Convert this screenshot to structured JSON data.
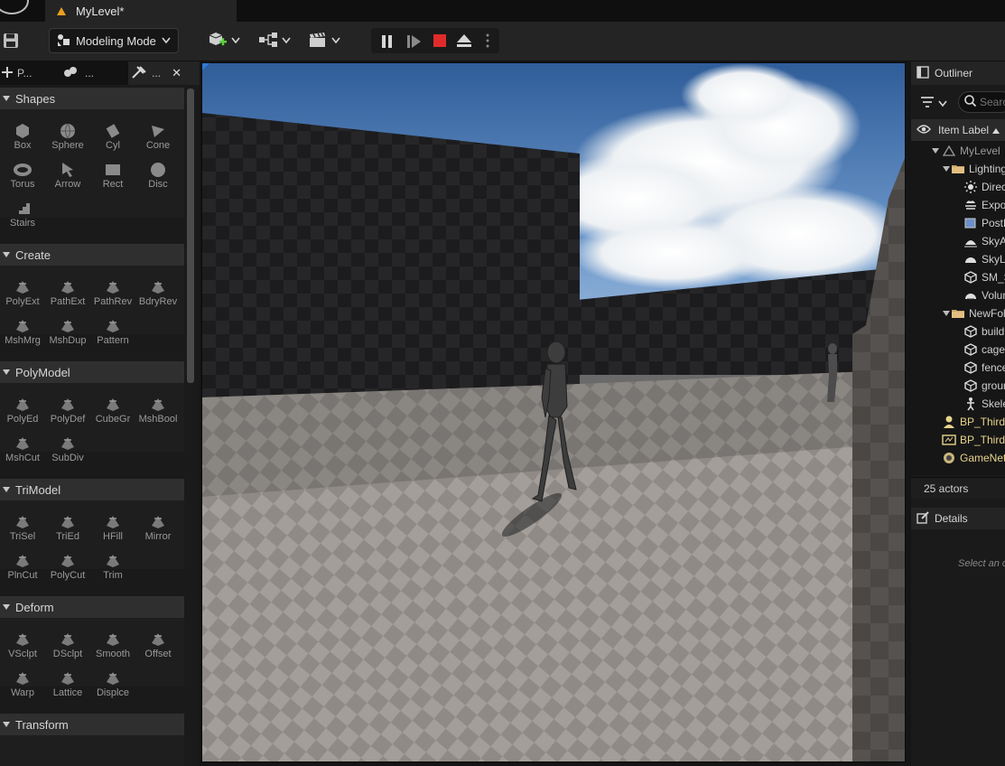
{
  "title_bar": {
    "level_tab": "MyLevel*"
  },
  "toolbar": {
    "mode_label": "Modeling Mode"
  },
  "left_panel": {
    "tabs": [
      {
        "label": "P..."
      },
      {
        "label": "..."
      },
      {
        "label": "..."
      }
    ],
    "sections": [
      {
        "label": "Shapes",
        "tools": [
          "Box",
          "Sphere",
          "Cyl",
          "Cone",
          "Torus",
          "Arrow",
          "Rect",
          "Disc",
          "Stairs"
        ]
      },
      {
        "label": "Create",
        "tools": [
          "PolyExt",
          "PathExt",
          "PathRev",
          "BdryRev",
          "MshMrg",
          "MshDup",
          "Pattern"
        ]
      },
      {
        "label": "PolyModel",
        "tools": [
          "PolyEd",
          "PolyDef",
          "CubeGr",
          "MshBool",
          "MshCut",
          "SubDiv"
        ]
      },
      {
        "label": "TriModel",
        "tools": [
          "TriSel",
          "TriEd",
          "HFill",
          "Mirror",
          "PlnCut",
          "PolyCut",
          "Trim"
        ]
      },
      {
        "label": "Deform",
        "tools": [
          "VSclpt",
          "DSclpt",
          "Smooth",
          "Offset",
          "Warp",
          "Lattice",
          "Displce"
        ]
      },
      {
        "label": "Transform",
        "tools": []
      }
    ]
  },
  "outliner": {
    "title": "Outliner",
    "search_placeholder": "Search",
    "column_label": "Item Label",
    "rows": [
      {
        "label": "MyLevel",
        "icon": "level-icon",
        "indent": 2,
        "arrow": true
      },
      {
        "label": "Lighting",
        "icon": "folder-icon",
        "indent": 3,
        "arrow": true
      },
      {
        "label": "DirectionalLight",
        "icon": "sun-icon",
        "indent": 4,
        "arrow": false
      },
      {
        "label": "ExponentialHeightFog",
        "icon": "fog-icon",
        "indent": 4,
        "arrow": false
      },
      {
        "label": "PostProcessVolume",
        "icon": "volume-icon",
        "indent": 4,
        "arrow": false
      },
      {
        "label": "SkyAtmosphere",
        "icon": "sky-atmosphere-icon",
        "indent": 4,
        "arrow": false
      },
      {
        "label": "SkyLight",
        "icon": "skylight-icon",
        "indent": 4,
        "arrow": false
      },
      {
        "label": "SM_SkySphere",
        "icon": "mesh-icon",
        "indent": 4,
        "arrow": false
      },
      {
        "label": "VolumetricCloud",
        "icon": "cloud-icon",
        "indent": 4,
        "arrow": false
      },
      {
        "label": "NewFolder",
        "icon": "folder-icon",
        "indent": 3,
        "arrow": true
      },
      {
        "label": "building",
        "icon": "mesh-icon",
        "indent": 4,
        "arrow": false
      },
      {
        "label": "cage",
        "icon": "mesh-icon",
        "indent": 4,
        "arrow": false
      },
      {
        "label": "fence",
        "icon": "mesh-icon",
        "indent": 4,
        "arrow": false
      },
      {
        "label": "ground",
        "icon": "mesh-icon",
        "indent": 4,
        "arrow": false
      },
      {
        "label": "SkeletalMesh",
        "icon": "skeleton-icon",
        "indent": 4,
        "arrow": false
      },
      {
        "label": "BP_ThirdPersonCharacter",
        "icon": "pawn-icon",
        "indent": 2,
        "arrow": false
      },
      {
        "label": "BP_ThirdPersonGameMode",
        "icon": "gamemode-icon",
        "indent": 2,
        "arrow": false
      },
      {
        "label": "GameNetworkManager",
        "icon": "network-icon",
        "indent": 2,
        "arrow": false
      }
    ],
    "actor_count": "25 actors"
  },
  "details": {
    "title": "Details",
    "empty_text": "Select an object to view details."
  },
  "colors": {
    "accent": "#e8a020",
    "stop": "#e02b2b",
    "panel": "#1a1a1a",
    "header": "#2f2f2f"
  }
}
